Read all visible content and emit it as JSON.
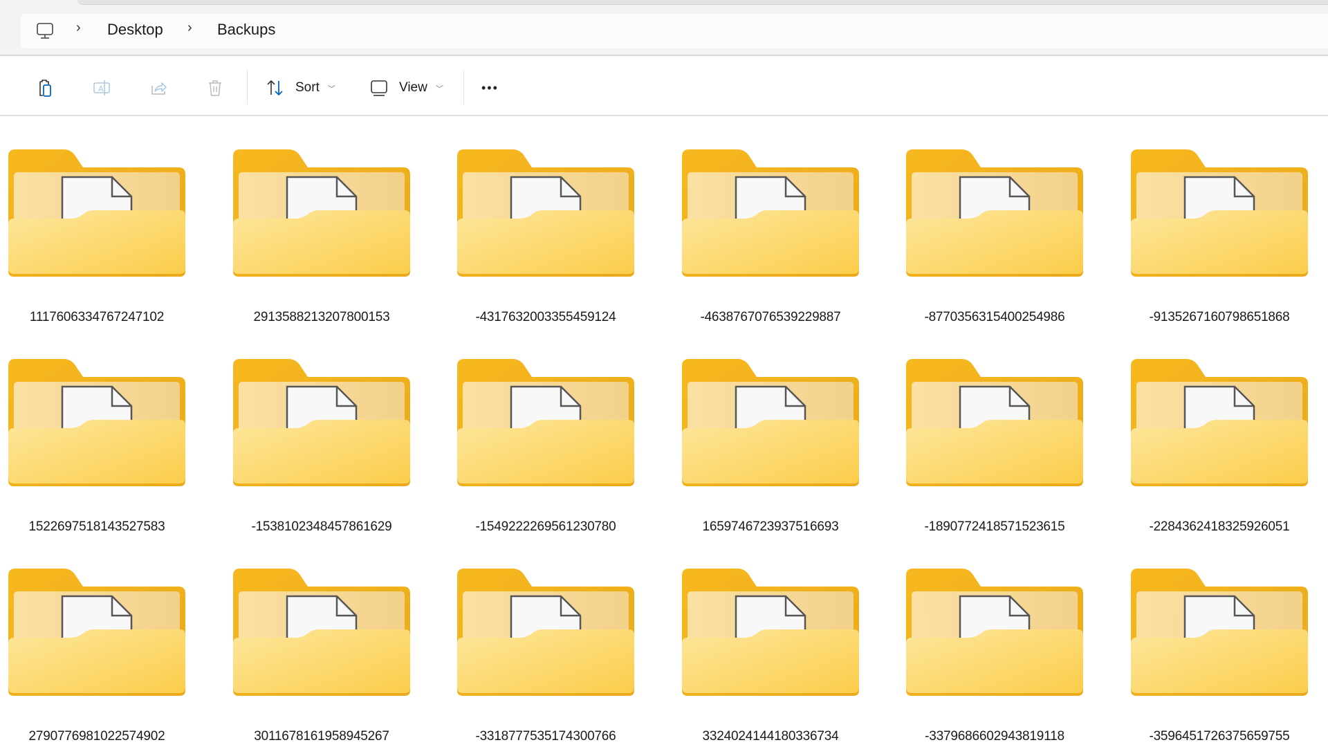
{
  "breadcrumb": {
    "root_icon": "this-pc-icon",
    "items": [
      "Desktop",
      "Backups"
    ],
    "separator_icon": "chevron-right-icon"
  },
  "toolbar": {
    "paste": {
      "icon": "paste-icon",
      "enabled": true
    },
    "rename": {
      "icon": "rename-icon",
      "enabled": false
    },
    "share": {
      "icon": "share-icon",
      "enabled": false
    },
    "delete": {
      "icon": "delete-icon",
      "enabled": false
    },
    "sort_label": "Sort",
    "view_label": "View",
    "more_label": "•••"
  },
  "colors": {
    "folder_back": "#f4b51f",
    "folder_front": "#fdd872",
    "accent": "#0067c0"
  },
  "folders": [
    "1117606334767247102",
    "2913588213207800153",
    "-4317632003355459124",
    "-4638767076539229887",
    "-8770356315400254986",
    "-9135267160798651868",
    "1522697518143527583",
    "-1538102348457861629",
    "-1549222269561230780",
    "1659746723937516693",
    "-1890772418571523615",
    "-2284362418325926051",
    "2790776981022574902",
    "3011678161958945267",
    "-3318777535174300766",
    "3324024144180336734",
    "-3379686602943819118",
    "-3596451726375659755"
  ]
}
